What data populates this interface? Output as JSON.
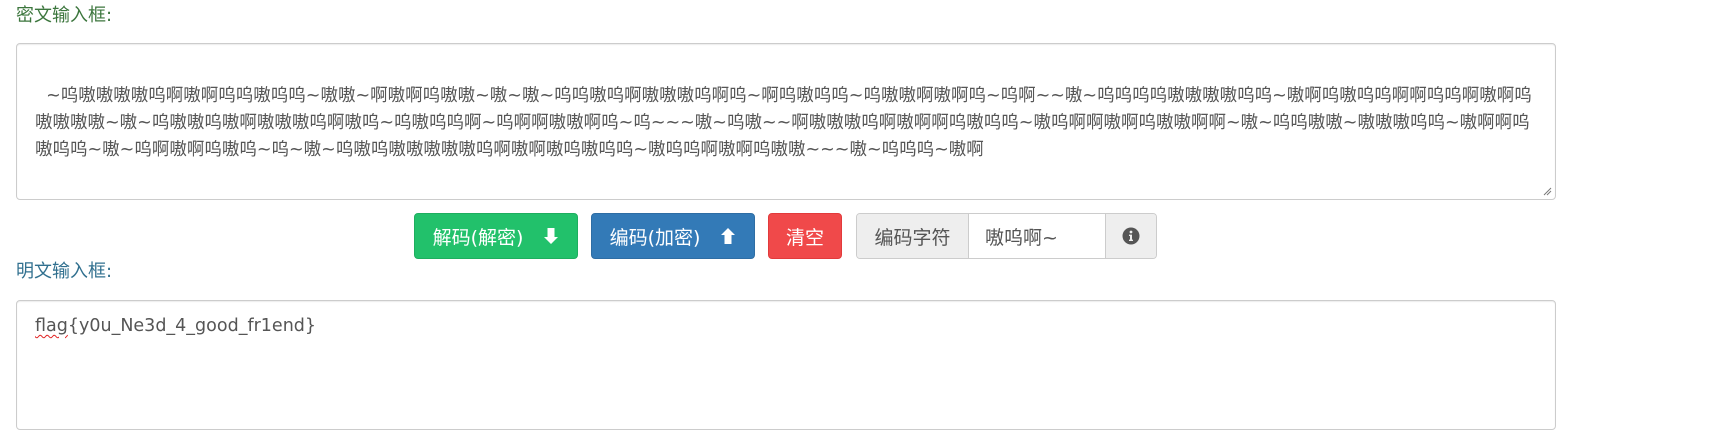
{
  "cipher": {
    "label": "密文输入框:",
    "text": "~呜嗷嗷嗷嗷呜啊嗷啊呜呜嗷呜呜~嗷嗷~啊嗷啊呜嗷嗷~嗷~嗷~呜呜嗷呜啊嗷嗷嗷呜啊呜~啊呜嗷呜呜~呜嗷嗷啊嗷啊呜~呜啊~~嗷~呜呜呜呜嗷嗷嗷嗷呜呜~嗷啊呜嗷呜呜啊啊呜呜啊嗷啊呜嗷嗷嗷嗷~嗷~呜嗷嗷呜嗷啊嗷嗷嗷呜啊嗷呜~呜嗷呜呜啊~呜啊啊嗷嗷啊呜~呜~~~嗷~呜嗷~~啊嗷嗷嗷呜啊嗷啊啊呜嗷呜呜~嗷呜啊啊嗷啊呜嗷嗷啊啊~嗷~呜呜嗷嗷~嗷嗷嗷呜呜~嗷啊啊呜嗷呜呜~嗷~呜啊嗷啊呜嗷呜~呜~嗷~呜嗷呜嗷嗷嗷嗷嗷呜啊嗷啊嗷呜嗷呜呜~嗷呜呜啊嗷啊呜嗷嗷~~~嗷~呜呜呜~嗷啊"
  },
  "buttons": {
    "decode_label": "解码(解密)",
    "encode_label": "编码(加密)",
    "clear_label": "清空"
  },
  "charset": {
    "label": "编码字符",
    "value": "嗷呜啊~"
  },
  "plain": {
    "label": "明文输入框:",
    "text_misspelled": "flag",
    "text_rest": "{y0u_Ne3d_4_good_fr1end}"
  },
  "icons": {
    "decode": "arrow-down-icon",
    "encode": "arrow-up-icon",
    "info": "info-circle-icon"
  },
  "colors": {
    "cipher_label": "#3c763d",
    "plain_label": "#31708f",
    "decode_button": "#22c16b",
    "encode_button": "#337ab7",
    "clear_button": "#f0494a"
  }
}
